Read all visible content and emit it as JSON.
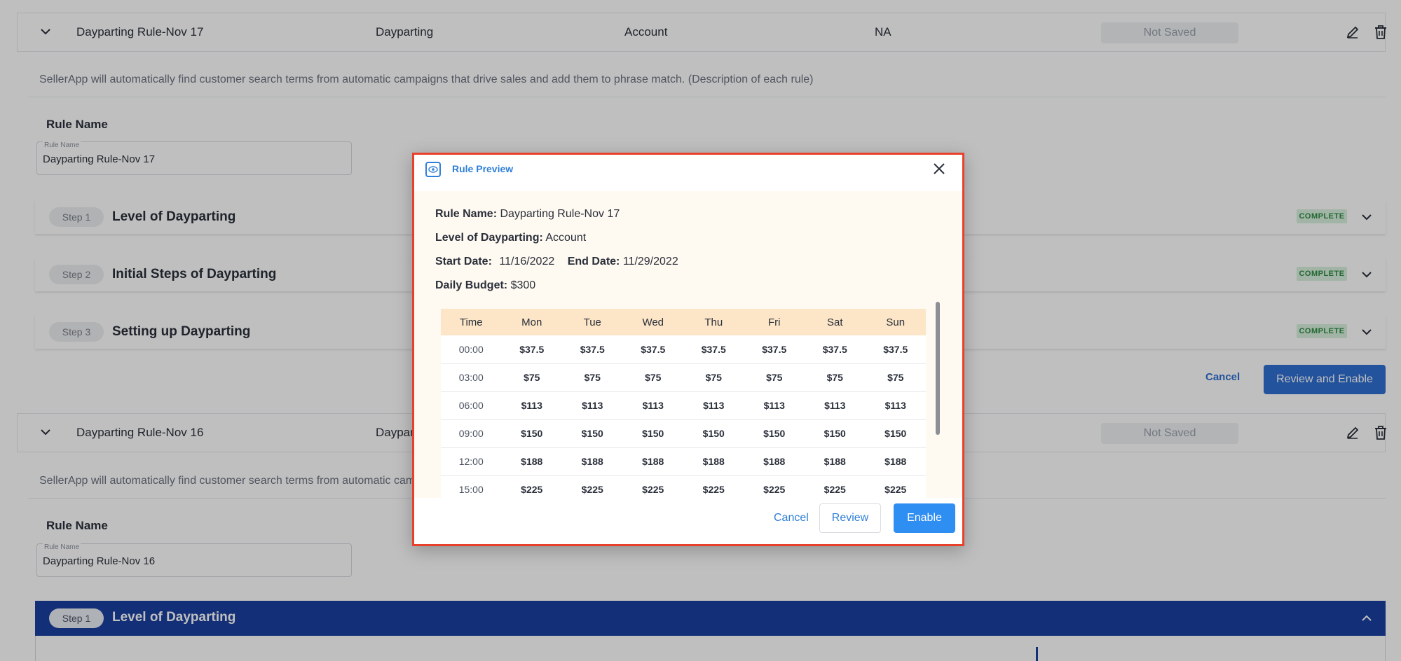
{
  "rules": [
    {
      "name": "Dayparting Rule-Nov 17",
      "type": "Dayparting",
      "level": "Account",
      "target": "NA",
      "status": "Not Saved",
      "description": "SellerApp will automatically find customer search terms from automatic campaigns that drive sales and add them to phrase match. (Description of each rule)",
      "rule_name_heading": "Rule Name",
      "rule_name_label": "Rule Name",
      "rule_name_value": "Dayparting Rule-Nov 17",
      "steps": [
        {
          "pill": "Step 1",
          "title": "Level of Dayparting",
          "badge": "COMPLETE"
        },
        {
          "pill": "Step 2",
          "title": "Initial Steps of Dayparting",
          "badge": "COMPLETE"
        },
        {
          "pill": "Step 3",
          "title": "Setting up Dayparting",
          "badge": "COMPLETE"
        }
      ],
      "cancel_label": "Cancel",
      "review_enable_label": "Review and Enable"
    },
    {
      "name": "Dayparting Rule-Nov 16",
      "type": "Dayparting",
      "status": "Not Saved",
      "description": "SellerApp will automatically find customer search terms from automatic campaigns that drive sales and add them to phrase match. (Description of each rule)",
      "rule_name_heading": "Rule Name",
      "rule_name_label": "Rule Name",
      "rule_name_value": "Dayparting Rule-Nov 16",
      "active_step": {
        "pill": "Step 1",
        "title": "Level of Dayparting"
      }
    }
  ],
  "modal": {
    "title": "Rule Preview",
    "rule_name_label": "Rule Name:",
    "rule_name_value": "Dayparting Rule-Nov 17",
    "level_label": "Level of Dayparting:",
    "level_value": "Account",
    "start_label": "Start Date:",
    "start_value": "11/16/2022",
    "end_label": "End Date:",
    "end_value": "11/29/2022",
    "budget_label": "Daily Budget:",
    "budget_value": "$300",
    "table": {
      "headers": [
        "Time",
        "Mon",
        "Tue",
        "Wed",
        "Thu",
        "Fri",
        "Sat",
        "Sun"
      ],
      "rows": [
        [
          "00:00",
          "$37.5",
          "$37.5",
          "$37.5",
          "$37.5",
          "$37.5",
          "$37.5",
          "$37.5"
        ],
        [
          "03:00",
          "$75",
          "$75",
          "$75",
          "$75",
          "$75",
          "$75",
          "$75"
        ],
        [
          "06:00",
          "$113",
          "$113",
          "$113",
          "$113",
          "$113",
          "$113",
          "$113"
        ],
        [
          "09:00",
          "$150",
          "$150",
          "$150",
          "$150",
          "$150",
          "$150",
          "$150"
        ],
        [
          "12:00",
          "$188",
          "$188",
          "$188",
          "$188",
          "$188",
          "$188",
          "$188"
        ],
        [
          "15:00",
          "$225",
          "$225",
          "$225",
          "$225",
          "$225",
          "$225",
          "$225"
        ]
      ]
    },
    "cancel_label": "Cancel",
    "review_label": "Review",
    "enable_label": "Enable"
  },
  "colors": {
    "accent": "#2f7fd8",
    "primary_button": "#2f6fd1",
    "active_step_bg": "#1a3fa0",
    "highlight_border": "#e8412b",
    "complete_badge": "#d8f1dc",
    "table_header": "#fde6c7"
  }
}
